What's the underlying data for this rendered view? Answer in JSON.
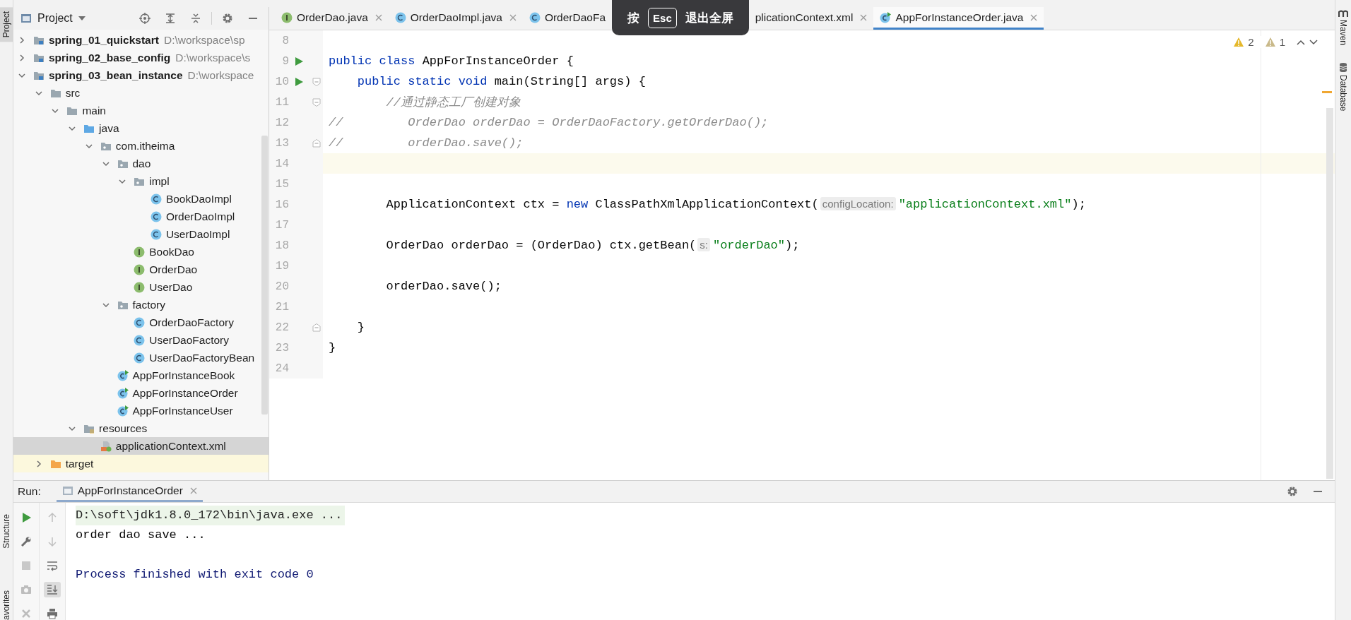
{
  "left_toolbar": [
    {
      "label": "Project",
      "selected": true
    },
    {
      "label": "Structure",
      "selected": false
    },
    {
      "label": "avorites",
      "selected": false
    }
  ],
  "project_panel": {
    "title": "Project",
    "tree": [
      {
        "label": "spring_01_quickstart",
        "path": "D:\\workspace\\sp",
        "kind": "module",
        "expanded": false,
        "selected": false
      },
      {
        "label": "spring_02_base_config",
        "path": "D:\\workspace\\s",
        "kind": "module",
        "expanded": false,
        "selected": false
      },
      {
        "label": "spring_03_bean_instance",
        "path": "D:\\workspace",
        "kind": "module",
        "expanded": true,
        "selected": false,
        "children": [
          {
            "label": "src",
            "kind": "folder",
            "expanded": true,
            "selected": false,
            "children": [
              {
                "label": "main",
                "kind": "folder",
                "expanded": true,
                "selected": false,
                "children": [
                  {
                    "label": "java",
                    "kind": "source-root",
                    "expanded": true,
                    "selected": false,
                    "children": [
                      {
                        "label": "com.itheima",
                        "kind": "package",
                        "expanded": true,
                        "selected": false,
                        "children": [
                          {
                            "label": "dao",
                            "kind": "package",
                            "expanded": true,
                            "selected": false,
                            "children": [
                              {
                                "label": "impl",
                                "kind": "package",
                                "expanded": true,
                                "selected": false,
                                "children": [
                                  {
                                    "label": "BookDaoImpl",
                                    "kind": "class",
                                    "selected": false
                                  },
                                  {
                                    "label": "OrderDaoImpl",
                                    "kind": "class",
                                    "selected": false
                                  },
                                  {
                                    "label": "UserDaoImpl",
                                    "kind": "class",
                                    "selected": false
                                  }
                                ]
                              },
                              {
                                "label": "BookDao",
                                "kind": "interface",
                                "selected": false
                              },
                              {
                                "label": "OrderDao",
                                "kind": "interface",
                                "selected": false
                              },
                              {
                                "label": "UserDao",
                                "kind": "interface",
                                "selected": false
                              }
                            ]
                          },
                          {
                            "label": "factory",
                            "kind": "package",
                            "expanded": true,
                            "selected": false,
                            "children": [
                              {
                                "label": "OrderDaoFactory",
                                "kind": "class",
                                "selected": false
                              },
                              {
                                "label": "UserDaoFactory",
                                "kind": "class",
                                "selected": false
                              },
                              {
                                "label": "UserDaoFactoryBean",
                                "kind": "class",
                                "selected": false
                              }
                            ]
                          },
                          {
                            "label": "AppForInstanceBook",
                            "kind": "main-class",
                            "selected": false
                          },
                          {
                            "label": "AppForInstanceOrder",
                            "kind": "main-class",
                            "selected": false
                          },
                          {
                            "label": "AppForInstanceUser",
                            "kind": "main-class",
                            "selected": false
                          }
                        ]
                      }
                    ]
                  },
                  {
                    "label": "resources",
                    "kind": "resources",
                    "expanded": true,
                    "selected": false,
                    "children": [
                      {
                        "label": "applicationContext.xml",
                        "kind": "xml",
                        "selected": true
                      }
                    ]
                  }
                ]
              }
            ]
          },
          {
            "label": "target",
            "kind": "excluded",
            "expanded": false,
            "selected": false
          }
        ]
      }
    ]
  },
  "editor": {
    "tabs": [
      {
        "label": "OrderDao.java",
        "kind": "interface",
        "closable": true,
        "selected": false
      },
      {
        "label": "OrderDaoImpl.java",
        "kind": "class",
        "closable": true,
        "selected": false
      },
      {
        "label": "OrderDaoFa",
        "kind": "class",
        "closable": false,
        "selected": false
      },
      {
        "label": "plicationContext.xml",
        "closable": true,
        "selected": false
      },
      {
        "label": "AppForInstanceOrder.java",
        "kind": "main-class",
        "closable": true,
        "selected": true
      }
    ],
    "fullscreen_hint": {
      "before": "按",
      "key": "Esc",
      "after": "退出全屏"
    },
    "warnings": "2",
    "weak_warnings": "1",
    "lines": [
      {
        "number": "8",
        "current": false,
        "runnable": false,
        "fold_start": false,
        "fold_end": false
      },
      {
        "number": "9",
        "current": false,
        "runnable": true,
        "fold_start": false,
        "fold_end": false,
        "parts": [
          {
            "text": "public class ",
            "kind": "keyword"
          },
          {
            "text": "AppForInstanceOrder {",
            "kind": "plain"
          }
        ]
      },
      {
        "number": "10",
        "current": false,
        "runnable": true,
        "fold_start": true,
        "fold_end": false,
        "parts": [
          {
            "text": "    public static void ",
            "kind": "keyword"
          },
          {
            "text": "main(String[] args) {",
            "kind": "plain"
          }
        ]
      },
      {
        "number": "11",
        "current": false,
        "runnable": false,
        "fold_start": true,
        "fold_end": false,
        "parts": [
          {
            "text": "        //通过静态工厂创建对象",
            "kind": "comment"
          }
        ]
      },
      {
        "number": "12",
        "current": false,
        "runnable": false,
        "fold_start": false,
        "fold_end": false,
        "parts": [
          {
            "text": "//         OrderDao orderDao = OrderDaoFactory.getOrderDao();",
            "kind": "comment"
          }
        ]
      },
      {
        "number": "13",
        "current": false,
        "runnable": false,
        "fold_start": false,
        "fold_end": true,
        "parts": [
          {
            "text": "//         orderDao.save();",
            "kind": "comment"
          }
        ]
      },
      {
        "number": "14",
        "current": true,
        "runnable": false,
        "fold_start": false,
        "fold_end": false
      },
      {
        "number": "15",
        "current": false,
        "runnable": false,
        "fold_start": false,
        "fold_end": false
      },
      {
        "number": "16",
        "current": false,
        "runnable": false,
        "fold_start": false,
        "fold_end": false,
        "parts": [
          {
            "text": "        ApplicationContext ctx = ",
            "kind": "plain"
          },
          {
            "text": "new",
            "kind": "keyword"
          },
          {
            "text": " ClassPathXmlApplicationContext(",
            "kind": "plain"
          },
          {
            "text": "configLocation:",
            "kind": "hint"
          },
          {
            "text": "\"applicationContext.xml\"",
            "kind": "string"
          },
          {
            "text": ");",
            "kind": "plain"
          }
        ]
      },
      {
        "number": "17",
        "current": false,
        "runnable": false,
        "fold_start": false,
        "fold_end": false
      },
      {
        "number": "18",
        "current": false,
        "runnable": false,
        "fold_start": false,
        "fold_end": false,
        "parts": [
          {
            "text": "        OrderDao orderDao = (OrderDao) ctx.getBean(",
            "kind": "plain"
          },
          {
            "text": "s:",
            "kind": "hint"
          },
          {
            "text": "\"orderDao\"",
            "kind": "string"
          },
          {
            "text": ");",
            "kind": "plain"
          }
        ]
      },
      {
        "number": "19",
        "current": false,
        "runnable": false,
        "fold_start": false,
        "fold_end": false
      },
      {
        "number": "20",
        "current": false,
        "runnable": false,
        "fold_start": false,
        "fold_end": false,
        "parts": [
          {
            "text": "        orderDao.save();",
            "kind": "plain"
          }
        ]
      },
      {
        "number": "21",
        "current": false,
        "runnable": false,
        "fold_start": false,
        "fold_end": false
      },
      {
        "number": "22",
        "current": false,
        "runnable": false,
        "fold_start": false,
        "fold_end": true,
        "parts": [
          {
            "text": "    }",
            "kind": "plain"
          }
        ]
      },
      {
        "number": "23",
        "current": false,
        "runnable": false,
        "fold_start": false,
        "fold_end": false,
        "parts": [
          {
            "text": "}",
            "kind": "plain"
          }
        ]
      },
      {
        "number": "24",
        "current": false,
        "runnable": false,
        "fold_start": false,
        "fold_end": false
      }
    ]
  },
  "run_panel": {
    "label": "Run:",
    "tabs": [
      {
        "label": "AppForInstanceOrder",
        "selected": true
      }
    ],
    "actions": [
      {
        "kind": "run"
      },
      {
        "kind": "wrench"
      },
      {
        "kind": "stop"
      },
      {
        "kind": "camera"
      },
      {
        "kind": "close"
      }
    ],
    "tools": [
      {
        "kind": "up",
        "on": false
      },
      {
        "kind": "down",
        "on": false
      },
      {
        "kind": "wrap",
        "on": false
      },
      {
        "kind": "scroll-end",
        "on": true
      },
      {
        "kind": "print",
        "on": false
      }
    ],
    "output": [
      {
        "text": "D:\\soft\\jdk1.8.0_172\\bin\\java.exe ...",
        "kind": "command"
      },
      {
        "text": "order dao save ...",
        "kind": "stdout"
      },
      {
        "text": "Process finished with exit code 0",
        "kind": "system"
      }
    ]
  },
  "right_toolbar": [
    {
      "label": "Maven"
    },
    {
      "label": "Database"
    }
  ]
}
